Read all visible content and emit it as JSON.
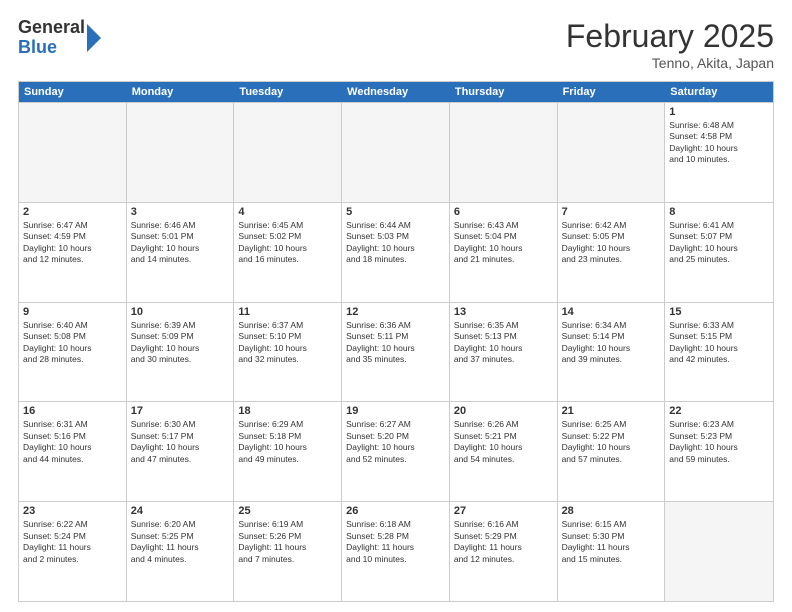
{
  "header": {
    "logo_general": "General",
    "logo_blue": "Blue",
    "month_title": "February 2025",
    "location": "Tenno, Akita, Japan"
  },
  "weekdays": [
    "Sunday",
    "Monday",
    "Tuesday",
    "Wednesday",
    "Thursday",
    "Friday",
    "Saturday"
  ],
  "rows": [
    [
      {
        "day": "",
        "info": ""
      },
      {
        "day": "",
        "info": ""
      },
      {
        "day": "",
        "info": ""
      },
      {
        "day": "",
        "info": ""
      },
      {
        "day": "",
        "info": ""
      },
      {
        "day": "",
        "info": ""
      },
      {
        "day": "1",
        "info": "Sunrise: 6:48 AM\nSunset: 4:58 PM\nDaylight: 10 hours\nand 10 minutes."
      }
    ],
    [
      {
        "day": "2",
        "info": "Sunrise: 6:47 AM\nSunset: 4:59 PM\nDaylight: 10 hours\nand 12 minutes."
      },
      {
        "day": "3",
        "info": "Sunrise: 6:46 AM\nSunset: 5:01 PM\nDaylight: 10 hours\nand 14 minutes."
      },
      {
        "day": "4",
        "info": "Sunrise: 6:45 AM\nSunset: 5:02 PM\nDaylight: 10 hours\nand 16 minutes."
      },
      {
        "day": "5",
        "info": "Sunrise: 6:44 AM\nSunset: 5:03 PM\nDaylight: 10 hours\nand 18 minutes."
      },
      {
        "day": "6",
        "info": "Sunrise: 6:43 AM\nSunset: 5:04 PM\nDaylight: 10 hours\nand 21 minutes."
      },
      {
        "day": "7",
        "info": "Sunrise: 6:42 AM\nSunset: 5:05 PM\nDaylight: 10 hours\nand 23 minutes."
      },
      {
        "day": "8",
        "info": "Sunrise: 6:41 AM\nSunset: 5:07 PM\nDaylight: 10 hours\nand 25 minutes."
      }
    ],
    [
      {
        "day": "9",
        "info": "Sunrise: 6:40 AM\nSunset: 5:08 PM\nDaylight: 10 hours\nand 28 minutes."
      },
      {
        "day": "10",
        "info": "Sunrise: 6:39 AM\nSunset: 5:09 PM\nDaylight: 10 hours\nand 30 minutes."
      },
      {
        "day": "11",
        "info": "Sunrise: 6:37 AM\nSunset: 5:10 PM\nDaylight: 10 hours\nand 32 minutes."
      },
      {
        "day": "12",
        "info": "Sunrise: 6:36 AM\nSunset: 5:11 PM\nDaylight: 10 hours\nand 35 minutes."
      },
      {
        "day": "13",
        "info": "Sunrise: 6:35 AM\nSunset: 5:13 PM\nDaylight: 10 hours\nand 37 minutes."
      },
      {
        "day": "14",
        "info": "Sunrise: 6:34 AM\nSunset: 5:14 PM\nDaylight: 10 hours\nand 39 minutes."
      },
      {
        "day": "15",
        "info": "Sunrise: 6:33 AM\nSunset: 5:15 PM\nDaylight: 10 hours\nand 42 minutes."
      }
    ],
    [
      {
        "day": "16",
        "info": "Sunrise: 6:31 AM\nSunset: 5:16 PM\nDaylight: 10 hours\nand 44 minutes."
      },
      {
        "day": "17",
        "info": "Sunrise: 6:30 AM\nSunset: 5:17 PM\nDaylight: 10 hours\nand 47 minutes."
      },
      {
        "day": "18",
        "info": "Sunrise: 6:29 AM\nSunset: 5:18 PM\nDaylight: 10 hours\nand 49 minutes."
      },
      {
        "day": "19",
        "info": "Sunrise: 6:27 AM\nSunset: 5:20 PM\nDaylight: 10 hours\nand 52 minutes."
      },
      {
        "day": "20",
        "info": "Sunrise: 6:26 AM\nSunset: 5:21 PM\nDaylight: 10 hours\nand 54 minutes."
      },
      {
        "day": "21",
        "info": "Sunrise: 6:25 AM\nSunset: 5:22 PM\nDaylight: 10 hours\nand 57 minutes."
      },
      {
        "day": "22",
        "info": "Sunrise: 6:23 AM\nSunset: 5:23 PM\nDaylight: 10 hours\nand 59 minutes."
      }
    ],
    [
      {
        "day": "23",
        "info": "Sunrise: 6:22 AM\nSunset: 5:24 PM\nDaylight: 11 hours\nand 2 minutes."
      },
      {
        "day": "24",
        "info": "Sunrise: 6:20 AM\nSunset: 5:25 PM\nDaylight: 11 hours\nand 4 minutes."
      },
      {
        "day": "25",
        "info": "Sunrise: 6:19 AM\nSunset: 5:26 PM\nDaylight: 11 hours\nand 7 minutes."
      },
      {
        "day": "26",
        "info": "Sunrise: 6:18 AM\nSunset: 5:28 PM\nDaylight: 11 hours\nand 10 minutes."
      },
      {
        "day": "27",
        "info": "Sunrise: 6:16 AM\nSunset: 5:29 PM\nDaylight: 11 hours\nand 12 minutes."
      },
      {
        "day": "28",
        "info": "Sunrise: 6:15 AM\nSunset: 5:30 PM\nDaylight: 11 hours\nand 15 minutes."
      },
      {
        "day": "",
        "info": ""
      }
    ]
  ]
}
